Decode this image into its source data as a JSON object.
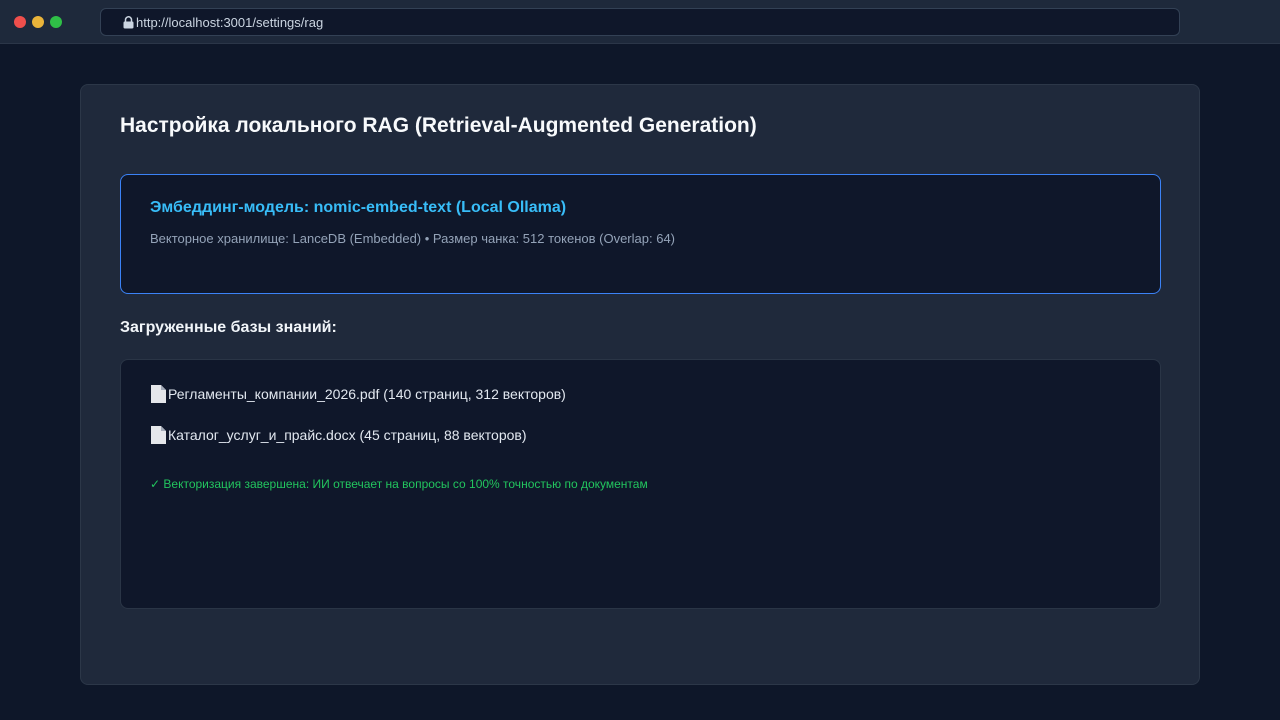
{
  "browser": {
    "url": "http://localhost:3001/settings/rag"
  },
  "page": {
    "title": "Настройка локального RAG (Retrieval-Augmented Generation)"
  },
  "embedding": {
    "title": "Эмбеддинг-модель: nomic-embed-text (Local Ollama)",
    "details": "Векторное хранилище: LanceDB (Embedded) • Размер чанка: 512 токенов (Overlap: 64)"
  },
  "knowledge_bases": {
    "heading": "Загруженные базы знаний:",
    "items": [
      {
        "label": "Регламенты_компании_2026.pdf (140 страниц, 312 векторов)",
        "icon": "document-icon"
      },
      {
        "label": "Каталог_услуг_и_прайс.docx (45 страниц, 88 векторов)",
        "icon": "document-icon"
      }
    ],
    "status": "✓ Векторизация завершена: ИИ отвечает на вопросы со 100% точностью по документам"
  },
  "colors": {
    "background": "#0e1729",
    "panel": "#1f293b",
    "card": "#0f172a",
    "accent_border": "#3b82f6",
    "accent_text": "#38bdf8",
    "success": "#22c55e",
    "close": "#ef4f4c",
    "minimize": "#eab43a",
    "maximize": "#2fbf47"
  }
}
